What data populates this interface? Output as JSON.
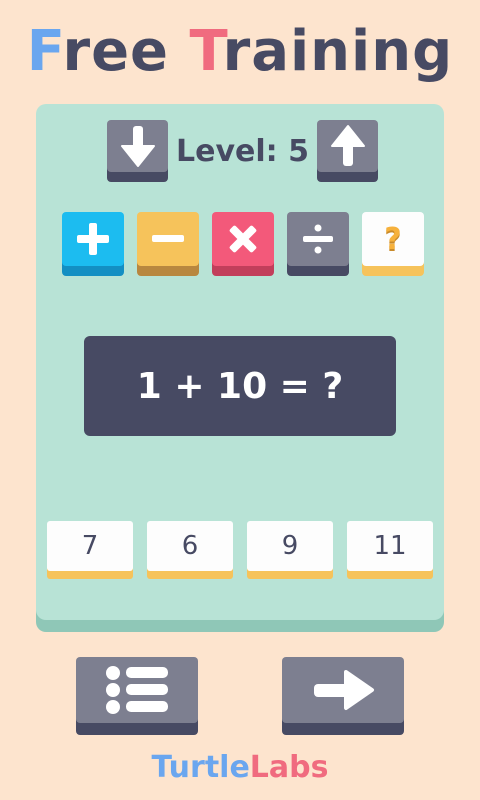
{
  "title": {
    "letter1": "F",
    "part1": "ree ",
    "letter2": "T",
    "part2": "raining"
  },
  "level": {
    "label": "Level: ",
    "value": "5",
    "down_icon": "arrow-down-icon",
    "up_icon": "arrow-up-icon"
  },
  "operations": [
    {
      "id": "plus",
      "symbol": "+"
    },
    {
      "id": "minus",
      "symbol": "−"
    },
    {
      "id": "times",
      "symbol": "×"
    },
    {
      "id": "divide",
      "symbol": "÷"
    },
    {
      "id": "random",
      "symbol": "?"
    }
  ],
  "question": "1 + 10 = ?",
  "answers": [
    "7",
    "6",
    "9",
    "11"
  ],
  "bottom": {
    "menu_icon": "list-icon",
    "next_icon": "arrow-right-icon"
  },
  "brand": {
    "part1": "Turtle",
    "part2": "Labs"
  },
  "colors": {
    "background": "#fde4ce",
    "board": "#b8e3d6",
    "dark": "#474a63",
    "gray": "#7d7f90",
    "blue": "#6aa6ef",
    "red": "#f06b7f",
    "cyan": "#1cbcf0",
    "yellow": "#f6c35b",
    "pink": "#f3597a"
  }
}
